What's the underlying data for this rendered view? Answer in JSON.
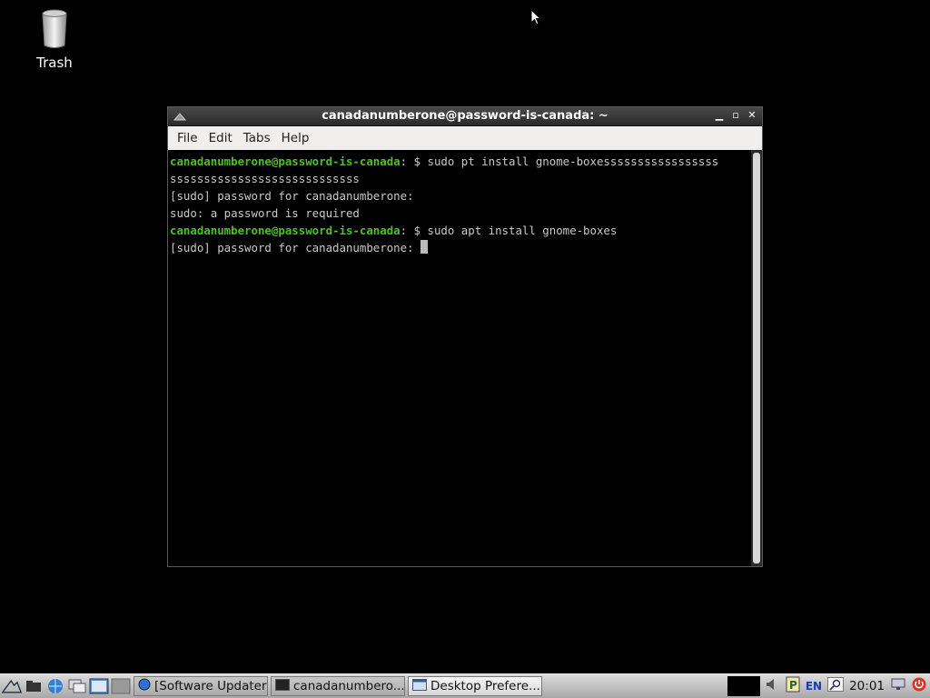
{
  "desktop": {
    "icons": [
      {
        "label": "Trash",
        "icon": "trash-icon"
      }
    ]
  },
  "window": {
    "title": "canadanumberone@password-is-canada: ~",
    "menu": [
      "File",
      "Edit",
      "Tabs",
      "Help"
    ],
    "terminal": {
      "lines": [
        {
          "prompt": "canadanumberone@password-is-canada",
          "text": ": $ sudo pt install gnome-boxesssssssssssssssss"
        },
        {
          "prompt": "",
          "text": "ssssssssssssssssssssssssssss"
        },
        {
          "prompt": "",
          "text": "[sudo] password for canadanumberone:"
        },
        {
          "prompt": "",
          "text": "sudo: a password is required"
        },
        {
          "prompt": "canadanumberone@password-is-canada",
          "text": ": $ sudo apt install gnome-boxes"
        },
        {
          "prompt": "",
          "text": "[sudo] password for canadanumberone: "
        }
      ]
    }
  },
  "taskbar": {
    "tasks": [
      {
        "label": "[Software Updater]",
        "icon": "globe-icon"
      },
      {
        "label": "canadanumbero...",
        "icon": "terminal-icon"
      },
      {
        "label": "Desktop Prefere...",
        "icon": "window-icon"
      }
    ],
    "tray": {
      "language": "EN",
      "clock": "20:01"
    }
  }
}
